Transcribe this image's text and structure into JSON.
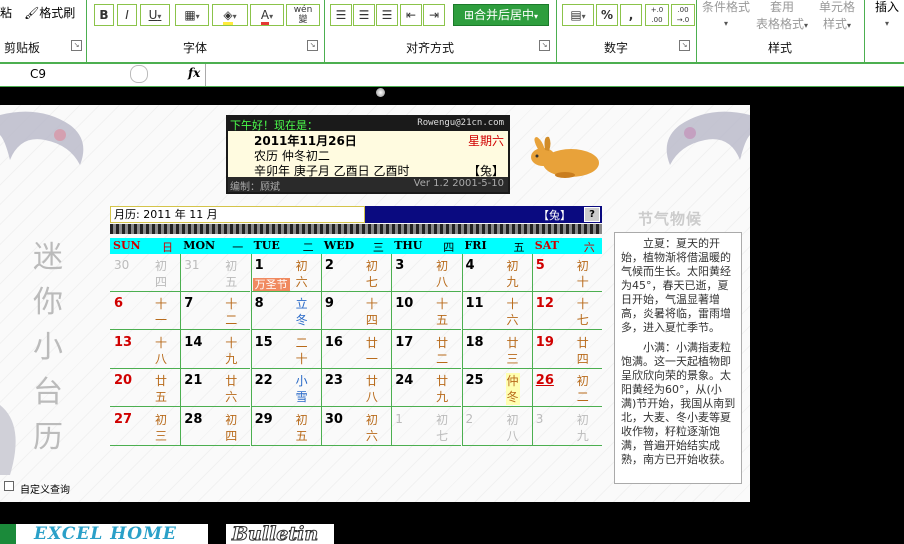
{
  "ribbon": {
    "clipboard": {
      "paste": "粘",
      "format_painter": "格式刷",
      "label": "剪贴板"
    },
    "font": {
      "label": "字体",
      "bold": "B",
      "italic": "I",
      "underline": "U",
      "wen": "wén",
      "wen2": "變"
    },
    "align": {
      "label": "对齐方式",
      "merge": "合并后居中"
    },
    "number": {
      "label": "数字",
      "percent": "%",
      "comma": ",",
      "inc": "+.0 .00",
      "dec": ".00 →.0"
    },
    "styles": {
      "label": "样式",
      "cond": "条件格式",
      "table": "套用",
      "table2": "表格格式",
      "cell": "单元格",
      "cell2": "样式"
    },
    "insert": {
      "label": "插入"
    }
  },
  "formula_bar": {
    "name_box": "C9",
    "fx": "fx"
  },
  "calendar": {
    "header": {
      "greeting": "下午好！现在是：",
      "email": "Rowengu@21cn.com",
      "date": "2011年11月26日",
      "weekday": "星期六",
      "lunar": "农历 仲冬初二",
      "ganzhi": "辛卯年 庚子月 乙酉日 乙酉时",
      "zodiac": "【兔】",
      "editor": "编制：顾斌",
      "version": "Ver 1.2 2001-5-10"
    },
    "month_bar": {
      "label": "月历: 2011 年 11 月",
      "zodiac": "【兔】",
      "help": "?"
    },
    "weekdays": [
      {
        "en": "SUN",
        "cn": "日"
      },
      {
        "en": "MON",
        "cn": "一"
      },
      {
        "en": "TUE",
        "cn": "二"
      },
      {
        "en": "WED",
        "cn": "三"
      },
      {
        "en": "THU",
        "cn": "四"
      },
      {
        "en": "FRI",
        "cn": "五"
      },
      {
        "en": "SAT",
        "cn": "六"
      }
    ],
    "weeks": [
      [
        {
          "d": "30",
          "l": "初四",
          "o": true
        },
        {
          "d": "31",
          "l": "初五",
          "o": true
        },
        {
          "d": "1",
          "l": "初六"
        },
        {
          "d": "2",
          "l": "初七"
        },
        {
          "d": "3",
          "l": "初八"
        },
        {
          "d": "4",
          "l": "初九"
        },
        {
          "d": "5",
          "l": "初十"
        }
      ],
      [
        {
          "d": "6",
          "l": "十一"
        },
        {
          "d": "7",
          "l": "十二"
        },
        {
          "d": "8",
          "l": "立冬",
          "term": true
        },
        {
          "d": "9",
          "l": "十四"
        },
        {
          "d": "10",
          "l": "十五"
        },
        {
          "d": "11",
          "l": "十六"
        },
        {
          "d": "12",
          "l": "十七"
        }
      ],
      [
        {
          "d": "13",
          "l": "十八"
        },
        {
          "d": "14",
          "l": "十九"
        },
        {
          "d": "15",
          "l": "二十"
        },
        {
          "d": "16",
          "l": "廿一"
        },
        {
          "d": "17",
          "l": "廿二"
        },
        {
          "d": "18",
          "l": "廿三"
        },
        {
          "d": "19",
          "l": "廿四"
        }
      ],
      [
        {
          "d": "20",
          "l": "廿五"
        },
        {
          "d": "21",
          "l": "廿六"
        },
        {
          "d": "22",
          "l": "小雪",
          "term": true
        },
        {
          "d": "23",
          "l": "廿八"
        },
        {
          "d": "24",
          "l": "廿九"
        },
        {
          "d": "25",
          "l": "仲冬",
          "hl": true
        },
        {
          "d": "26",
          "l": "初二",
          "today": true
        }
      ],
      [
        {
          "d": "27",
          "l": "初三"
        },
        {
          "d": "28",
          "l": "初四"
        },
        {
          "d": "29",
          "l": "初五"
        },
        {
          "d": "30",
          "l": "初六"
        },
        {
          "d": "1",
          "l": "初七",
          "o": true
        },
        {
          "d": "2",
          "l": "初八",
          "o": true
        },
        {
          "d": "3",
          "l": "初九",
          "o": true
        }
      ]
    ],
    "holiday": "万圣节",
    "side_title": "节气物候",
    "side_text": [
      "立夏：夏天的开始，植物渐将借温暖的气候而生长。太阳黄经为45°，春天已逝，夏日开始，气温显著增高，炎暑将临，雷雨增多，进入夏忙季节。",
      "小满：小满指麦粒饱满。这一天起植物即呈欣欣向荣的景象。太阳黄经为60°，从(小满)节开始，我国从南到北，大麦、冬小麦等夏收作物，籽粒逐渐饱满，普遍开始结实成熟，南方已开始收获。"
    ],
    "vertical_title": [
      "迷",
      "你",
      "小",
      "台",
      "历"
    ],
    "checkbox_label": "自定义查询"
  },
  "footer": {
    "logo1": "EXCEL HOME",
    "logo2": "Bulletin"
  },
  "colors": {
    "accent": "#4caf50",
    "navy": "#0a0a80",
    "cyan": "#00ffff",
    "red": "#d00000"
  }
}
